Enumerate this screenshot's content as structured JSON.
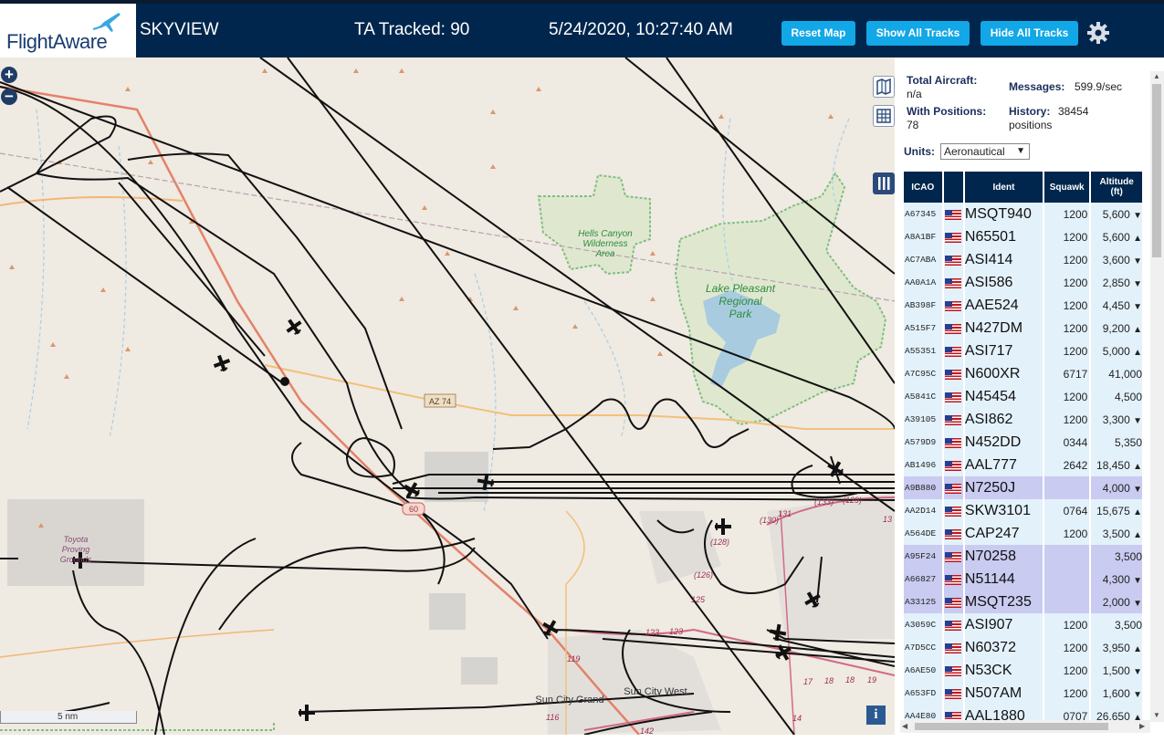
{
  "header": {
    "logo_text": "FlightAware",
    "app_title": "SKYVIEW",
    "tracked_label": "TA Tracked: 90",
    "datetime": "5/24/2020, 10:27:40 AM",
    "buttons": {
      "reset_map": "Reset Map",
      "show_all_tracks": "Show All Tracks",
      "hide_all_tracks": "Hide All Tracks"
    },
    "settings_icon": "gear-icon",
    "colors": {
      "bar": "#00264d",
      "button": "#12a7e6"
    }
  },
  "map": {
    "zoom_in": "+",
    "zoom_out": "−",
    "scale_label": "5 nm",
    "info_button": "i",
    "labels": {
      "hells_canyon_1": "Hells Canyon",
      "hells_canyon_2": "Wilderness",
      "hells_canyon_3": "Area",
      "lake_1": "Lake Pleasant",
      "lake_2": "Regional",
      "lake_3": "Park",
      "toyota_1": "Toyota",
      "toyota_2": "Proving",
      "toyota_3": "Grounds",
      "sun_city_grand": "Sun City Grand",
      "sun_city_west": "Sun City West",
      "az74": "AZ 74",
      "r60": "60",
      "r130": "(130)",
      "r131": "131",
      "r128": "(128)",
      "r126": "(126)",
      "r125": "125",
      "r123a": "123",
      "r123b": "123",
      "r119": "119",
      "r116": "116",
      "r142": "142",
      "r14": "14",
      "r17": "17",
      "r18a": "18",
      "r18b": "18",
      "r19": "19",
      "r13": "13",
      "r133": "(133)",
      "r129": "(129)"
    }
  },
  "stats": {
    "total_label": "Total Aircraft:",
    "total_value": "n/a",
    "with_pos_label": "With Positions:",
    "with_pos_value": "78",
    "messages_label": "Messages:",
    "messages_value": "599.9/sec",
    "history_label": "History:",
    "history_value": "38454",
    "history_unit": "positions",
    "units_label": "Units:",
    "units_value": "Aeronautical"
  },
  "table": {
    "headers": {
      "icao": "ICAO",
      "ident": "Ident",
      "squawk": "Squawk",
      "alt1": "Altitude",
      "alt2": "(ft)"
    },
    "rows": [
      {
        "icao": "A67345",
        "ident": "MSQT940",
        "squawk": "1200",
        "alt": "5,600",
        "trend": "▼",
        "sel": false
      },
      {
        "icao": "A8A1BF",
        "ident": "N65501",
        "squawk": "1200",
        "alt": "5,600",
        "trend": "▲",
        "sel": false
      },
      {
        "icao": "AC7ABA",
        "ident": "ASI414",
        "squawk": "1200",
        "alt": "3,600",
        "trend": "▼",
        "sel": false
      },
      {
        "icao": "AA0A1A",
        "ident": "ASI586",
        "squawk": "1200",
        "alt": "2,850",
        "trend": "▼",
        "sel": false
      },
      {
        "icao": "AB398F",
        "ident": "AAE524",
        "squawk": "1200",
        "alt": "4,450",
        "trend": "▼",
        "sel": false
      },
      {
        "icao": "A515F7",
        "ident": "N427DM",
        "squawk": "1200",
        "alt": "9,200",
        "trend": "▲",
        "sel": false
      },
      {
        "icao": "A55351",
        "ident": "ASI717",
        "squawk": "1200",
        "alt": "5,000",
        "trend": "▲",
        "sel": false
      },
      {
        "icao": "A7C95C",
        "ident": "N600XR",
        "squawk": "6717",
        "alt": "41,000",
        "trend": "",
        "sel": false
      },
      {
        "icao": "A5841C",
        "ident": "N45454",
        "squawk": "1200",
        "alt": "4,500",
        "trend": "",
        "sel": false
      },
      {
        "icao": "A39105",
        "ident": "ASI862",
        "squawk": "1200",
        "alt": "3,300",
        "trend": "▼",
        "sel": false
      },
      {
        "icao": "A579D9",
        "ident": "N452DD",
        "squawk": "0344",
        "alt": "5,350",
        "trend": "",
        "sel": false
      },
      {
        "icao": "AB1496",
        "ident": "AAL777",
        "squawk": "2642",
        "alt": "18,450",
        "trend": "▲",
        "sel": false
      },
      {
        "icao": "A9B880",
        "ident": "N7250J",
        "squawk": "",
        "alt": "4,000",
        "trend": "▼",
        "sel": true
      },
      {
        "icao": "AA2D14",
        "ident": "SKW3101",
        "squawk": "0764",
        "alt": "15,675",
        "trend": "▲",
        "sel": false
      },
      {
        "icao": "A564DE",
        "ident": "CAP247",
        "squawk": "1200",
        "alt": "3,500",
        "trend": "▲",
        "sel": false
      },
      {
        "icao": "A95F24",
        "ident": "N70258",
        "squawk": "",
        "alt": "3,500",
        "trend": "",
        "sel": true
      },
      {
        "icao": "A66827",
        "ident": "N51144",
        "squawk": "",
        "alt": "4,300",
        "trend": "▼",
        "sel": true
      },
      {
        "icao": "A33125",
        "ident": "MSQT235",
        "squawk": "",
        "alt": "2,000",
        "trend": "▼",
        "sel": true
      },
      {
        "icao": "A3059C",
        "ident": "ASI907",
        "squawk": "1200",
        "alt": "3,500",
        "trend": "",
        "sel": false
      },
      {
        "icao": "A7D5CC",
        "ident": "N60372",
        "squawk": "1200",
        "alt": "3,950",
        "trend": "▲",
        "sel": false
      },
      {
        "icao": "A6AE50",
        "ident": "N53CK",
        "squawk": "1200",
        "alt": "1,500",
        "trend": "▼",
        "sel": false
      },
      {
        "icao": "A653FD",
        "ident": "N507AM",
        "squawk": "1200",
        "alt": "1,600",
        "trend": "▼",
        "sel": false
      },
      {
        "icao": "AA4E80",
        "ident": "AAL1880",
        "squawk": "0707",
        "alt": "26,650",
        "trend": "▲",
        "sel": false
      }
    ]
  }
}
